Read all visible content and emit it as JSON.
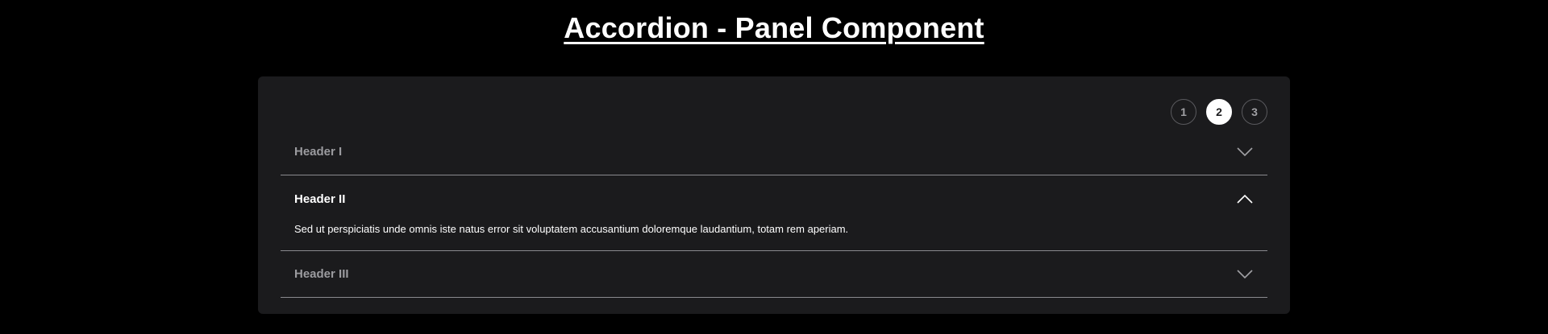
{
  "page": {
    "title": "Accordion - Panel Component"
  },
  "stepper": {
    "steps": [
      "1",
      "2",
      "3"
    ],
    "active_index": 1
  },
  "accordion": {
    "items": [
      {
        "header": "Header I",
        "expanded": false,
        "icon": "chevron-down-icon"
      },
      {
        "header": "Header II",
        "expanded": true,
        "icon": "chevron-up-icon",
        "content": "Sed ut perspiciatis unde omnis iste natus error sit voluptatem accusantium doloremque laudantium, totam rem aperiam."
      },
      {
        "header": "Header III",
        "expanded": false,
        "icon": "chevron-down-icon"
      }
    ]
  },
  "colors": {
    "background": "#000000",
    "card": "#1b1b1d",
    "text_active": "#ffffff",
    "text_muted": "#9b9b9f",
    "divider": "#8a8a8e"
  }
}
